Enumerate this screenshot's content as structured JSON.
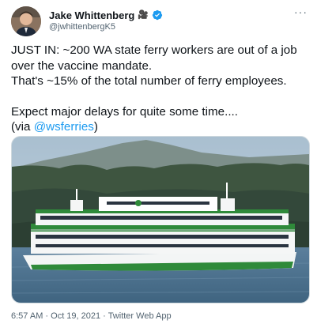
{
  "author": {
    "name": "Jake Whittenberg",
    "handle": "@jwhittenbergK5",
    "badge_icons": [
      "video-camera-icon",
      "verified-badge-icon"
    ]
  },
  "tweet": {
    "line1": "JUST IN: ~200 WA state ferry workers are out of a job over the vaccine mandate.",
    "line2": "That's ~15% of the total number of ferry employees.",
    "line3": "Expect major delays for quite some time....",
    "via_prefix": "(via ",
    "mention": "@wsferries",
    "via_suffix": ")"
  },
  "meta": {
    "timestamp": "6:57 AM · Oct 19, 2021 · Twitter Web App"
  },
  "colors": {
    "link": "#1d9bf0",
    "secondary_text": "#536471",
    "verified": "#1d9bf0",
    "ferry_green": "#2f8a3a"
  }
}
